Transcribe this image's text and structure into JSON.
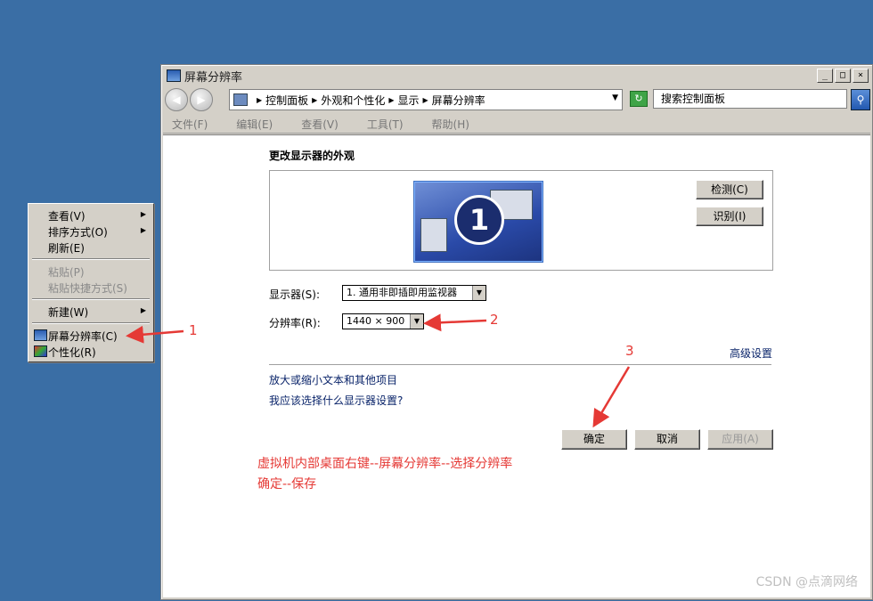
{
  "window": {
    "title": "屏幕分辨率",
    "controls": [
      "_",
      "□",
      "×"
    ]
  },
  "address": {
    "crumbs": [
      "控制面板",
      "外观和个性化",
      "显示",
      "屏幕分辨率"
    ],
    "search_placeholder": "搜索控制面板"
  },
  "menubar": [
    "文件(F)",
    "编辑(E)",
    "查看(V)",
    "工具(T)",
    "帮助(H)"
  ],
  "main": {
    "heading": "更改显示器的外观",
    "monitor_number": "1",
    "detect_button": "检测(C)",
    "identify_button": "识别(I)",
    "display_label": "显示器(S):",
    "display_value": "1. 通用非即插即用监视器",
    "resolution_label": "分辨率(R):",
    "resolution_value": "1440 × 900",
    "advanced_link": "高级设置",
    "link_text_size": "放大或缩小文本和其他项目",
    "link_which_settings": "我应该选择什么显示器设置?",
    "ok_button": "确定",
    "cancel_button": "取消",
    "apply_button": "应用(A)"
  },
  "instructions": {
    "line1": "虚拟机内部桌面右键--屏幕分辨率--选择分辨率",
    "line2": "确定--保存"
  },
  "context_menu": {
    "view": "查看(V)",
    "sort": "排序方式(O)",
    "refresh": "刷新(E)",
    "paste": "粘贴(P)",
    "paste_shortcut": "粘贴快捷方式(S)",
    "new": "新建(W)",
    "screen_resolution": "屏幕分辨率(C)",
    "personalize": "个性化(R)"
  },
  "annotations": {
    "n1": "1",
    "n2": "2",
    "n3": "3"
  },
  "watermark": "CSDN @点滴网络",
  "colors": {
    "desktop": "#3a6ea5",
    "annotation_red": "#e53935"
  }
}
